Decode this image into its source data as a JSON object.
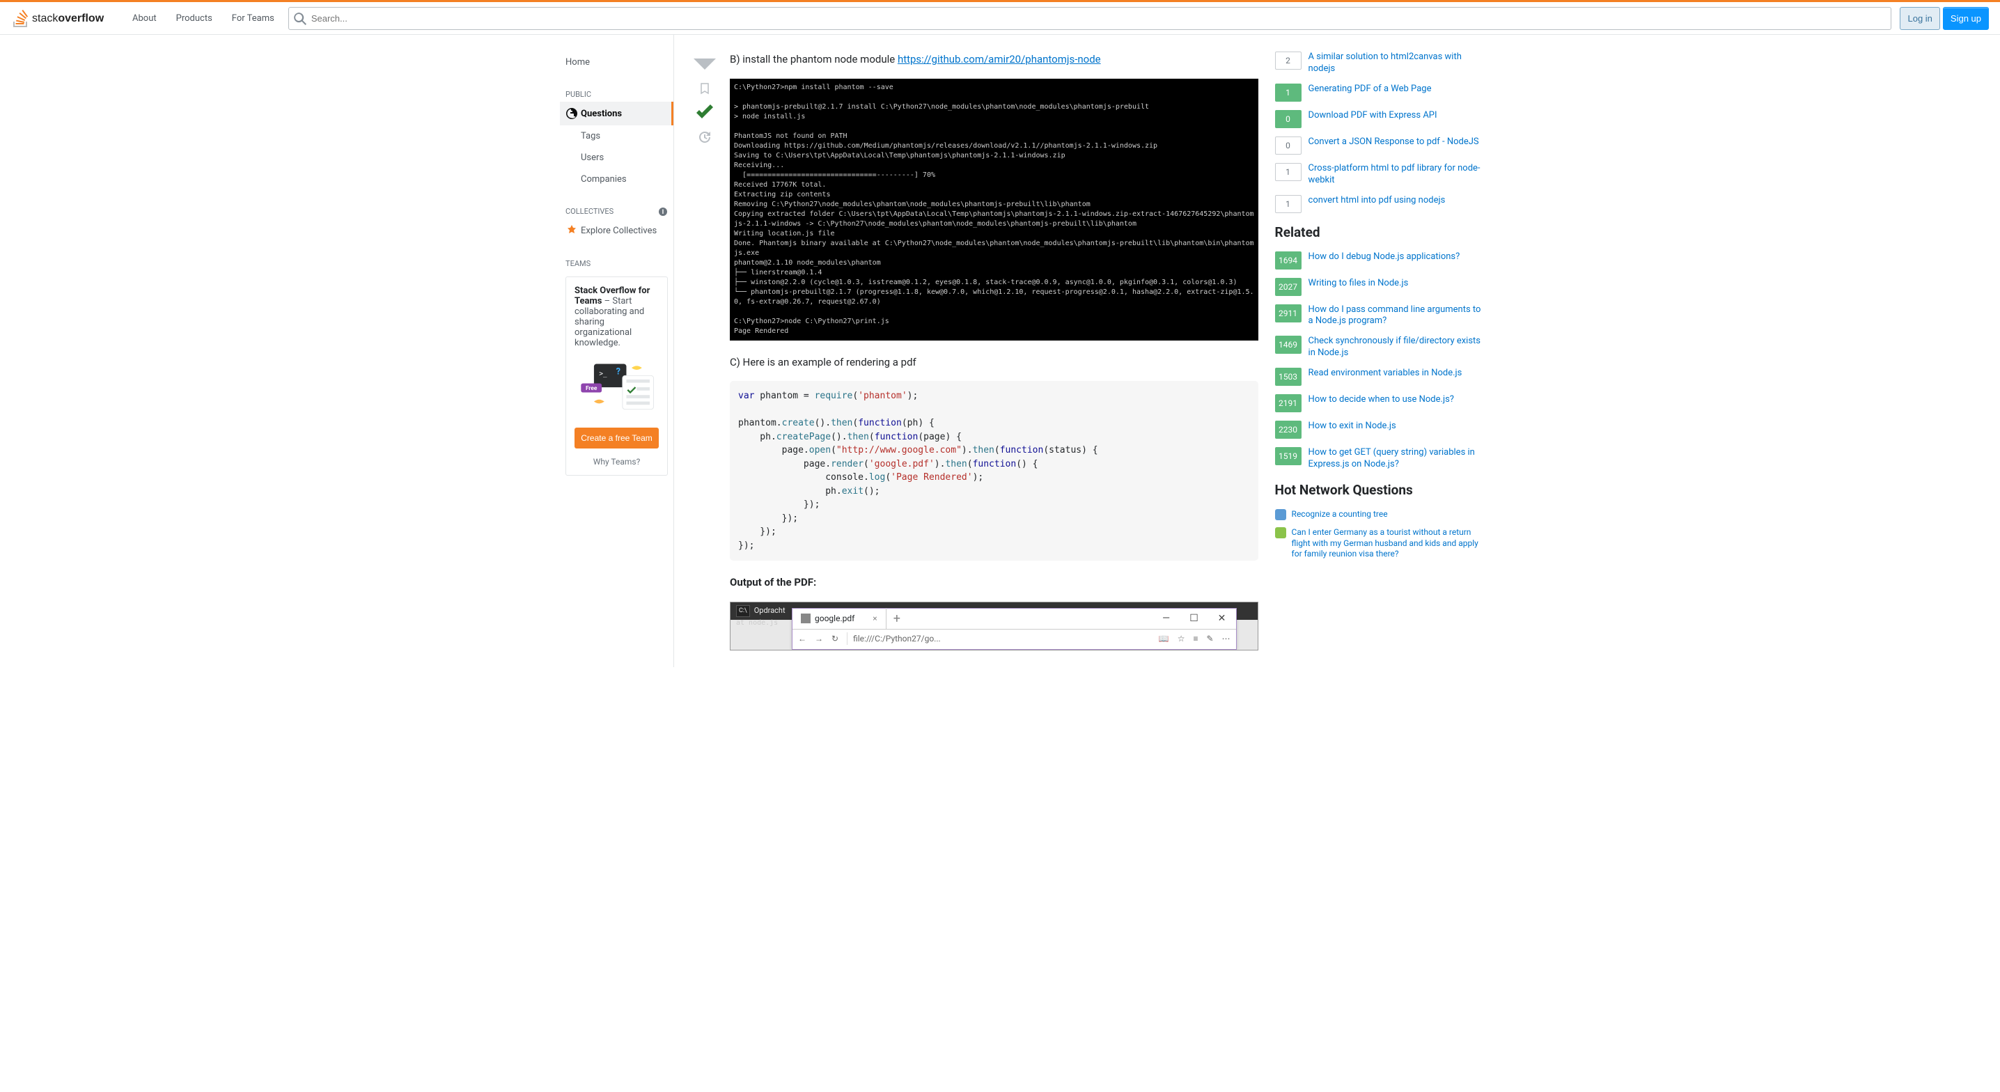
{
  "header": {
    "nav": [
      "About",
      "Products",
      "For Teams"
    ],
    "search_placeholder": "Search...",
    "login": "Log in",
    "signup": "Sign up"
  },
  "sidebar": {
    "home": "Home",
    "public_heading": "PUBLIC",
    "public_items": [
      "Questions",
      "Tags",
      "Users",
      "Companies"
    ],
    "collectives_heading": "COLLECTIVES",
    "explore_collectives": "Explore Collectives",
    "teams_heading": "TEAMS",
    "teams_card_title": "Stack Overflow for Teams",
    "teams_card_desc": " – Start collaborating and sharing organizational knowledge.",
    "teams_free_badge": "Free",
    "teams_cta": "Create a free Team",
    "teams_why": "Why Teams?"
  },
  "post": {
    "section_b_prefix": "B) install the phantom node module ",
    "section_b_link": "https://github.com/amir20/phantomjs-node",
    "terminal_output": "C:\\Python27>npm install phantom --save\n\n> phantomjs-prebuilt@2.1.7 install C:\\Python27\\node_modules\\phantom\\node_modules\\phantomjs-prebuilt\n> node install.js\n\nPhantomJS not found on PATH\nDownloading https://github.com/Medium/phantomjs/releases/download/v2.1.1//phantomjs-2.1.1-windows.zip\nSaving to C:\\Users\\tpt\\AppData\\Local\\Temp\\phantomjs\\phantomjs-2.1.1-windows.zip\nReceiving...\n  [===============================---------] 70%\nReceived 17767K total.\nExtracting zip contents\nRemoving C:\\Python27\\node_modules\\phantom\\node_modules\\phantomjs-prebuilt\\lib\\phantom\nCopying extracted folder C:\\Users\\tpt\\AppData\\Local\\Temp\\phantomjs\\phantomjs-2.1.1-windows.zip-extract-1467627645292\\phantom\njs-2.1.1-windows -> C:\\Python27\\node_modules\\phantom\\node_modules\\phantomjs-prebuilt\\lib\\phantom\nWriting location.js file\nDone. Phantomjs binary available at C:\\Python27\\node_modules\\phantom\\node_modules\\phantomjs-prebuilt\\lib\\phantom\\bin\\phantom\njs.exe\nphantom@2.1.10 node_modules\\phantom\n├── linerstream@0.1.4\n├── winston@2.2.0 (cycle@1.0.3, isstream@0.1.2, eyes@0.1.8, stack-trace@0.0.9, async@1.0.0, pkginfo@0.3.1, colors@1.0.3)\n└── phantomjs-prebuilt@2.1.7 (progress@1.1.8, kew@0.7.0, which@1.2.10, request-progress@2.0.1, hasha@2.2.0, extract-zip@1.5.\n0, fs-extra@0.26.7, request@2.67.0)\n\nC:\\Python27>node C:\\Python27\\print.js\nPage Rendered",
    "section_c": "C) Here is an example of rendering a pdf",
    "code": {
      "l1_var": "var",
      "l1_name": " phantom = ",
      "l1_require": "require",
      "l1_paren": "(",
      "l1_str": "'phantom'",
      "l1_end": ");",
      "l3_a": "phantom.",
      "l3_create": "create",
      "l3_b": "().",
      "l3_then": "then",
      "l3_c": "(",
      "l3_fn": "function",
      "l3_d": "(ph) {",
      "l4_a": "    ph.",
      "l4_cp": "createPage",
      "l4_b": "().",
      "l4_then": "then",
      "l4_c": "(",
      "l4_fn": "function",
      "l4_d": "(page) {",
      "l5_a": "        page.",
      "l5_open": "open",
      "l5_b": "(",
      "l5_url": "\"http://www.google.com\"",
      "l5_c": ").",
      "l5_then": "then",
      "l5_d": "(",
      "l5_fn": "function",
      "l5_e": "(status) {",
      "l6_a": "            page.",
      "l6_render": "render",
      "l6_b": "(",
      "l6_file": "'google.pdf'",
      "l6_c": ").",
      "l6_then": "then",
      "l6_d": "(",
      "l6_fn": "function",
      "l6_e": "() {",
      "l7_a": "                console.",
      "l7_log": "log",
      "l7_b": "(",
      "l7_msg": "'Page Rendered'",
      "l7_c": ");",
      "l8_a": "                ph.",
      "l8_exit": "exit",
      "l8_b": "();",
      "l9": "            });",
      "l10": "        });",
      "l11": "    });",
      "l12": "});"
    },
    "output_heading": "Output of the PDF:",
    "pdf_cmdbar": "Opdracht",
    "pdf_node": "at node.js",
    "pdf_tab_title": "google.pdf",
    "pdf_addr": "file:///C:/Python27/go..."
  },
  "linked": [
    {
      "votes": "2",
      "answered": false,
      "text": "A similar solution to html2canvas with nodejs"
    },
    {
      "votes": "1",
      "answered": true,
      "text": "Generating PDF of a Web Page"
    },
    {
      "votes": "0",
      "answered": true,
      "text": "Download PDF with Express API"
    },
    {
      "votes": "0",
      "answered": false,
      "text": "Convert a JSON Response to pdf - NodeJS"
    },
    {
      "votes": "1",
      "answered": false,
      "text": "Cross-platform html to pdf library for node-webkit"
    },
    {
      "votes": "1",
      "answered": false,
      "text": "convert html into pdf using nodejs"
    }
  ],
  "related_heading": "Related",
  "related": [
    {
      "votes": "1694",
      "text": "How do I debug Node.js applications?"
    },
    {
      "votes": "2027",
      "text": "Writing to files in Node.js"
    },
    {
      "votes": "2911",
      "text": "How do I pass command line arguments to a Node.js program?"
    },
    {
      "votes": "1469",
      "text": "Check synchronously if file/directory exists in Node.js"
    },
    {
      "votes": "1503",
      "text": "Read environment variables in Node.js"
    },
    {
      "votes": "2191",
      "text": "How to decide when to use Node.js?"
    },
    {
      "votes": "2230",
      "text": "How to exit in Node.js"
    },
    {
      "votes": "1519",
      "text": "How to get GET (query string) variables in Express.js on Node.js?"
    }
  ],
  "hnq_heading": "Hot Network Questions",
  "hnq": [
    {
      "color": "#5b9bd5",
      "text": "Recognize a counting tree"
    },
    {
      "color": "#8BC34A",
      "text": "Can I enter Germany as a tourist without a return flight with my German husband and kids and apply for family reunion visa there?"
    }
  ]
}
